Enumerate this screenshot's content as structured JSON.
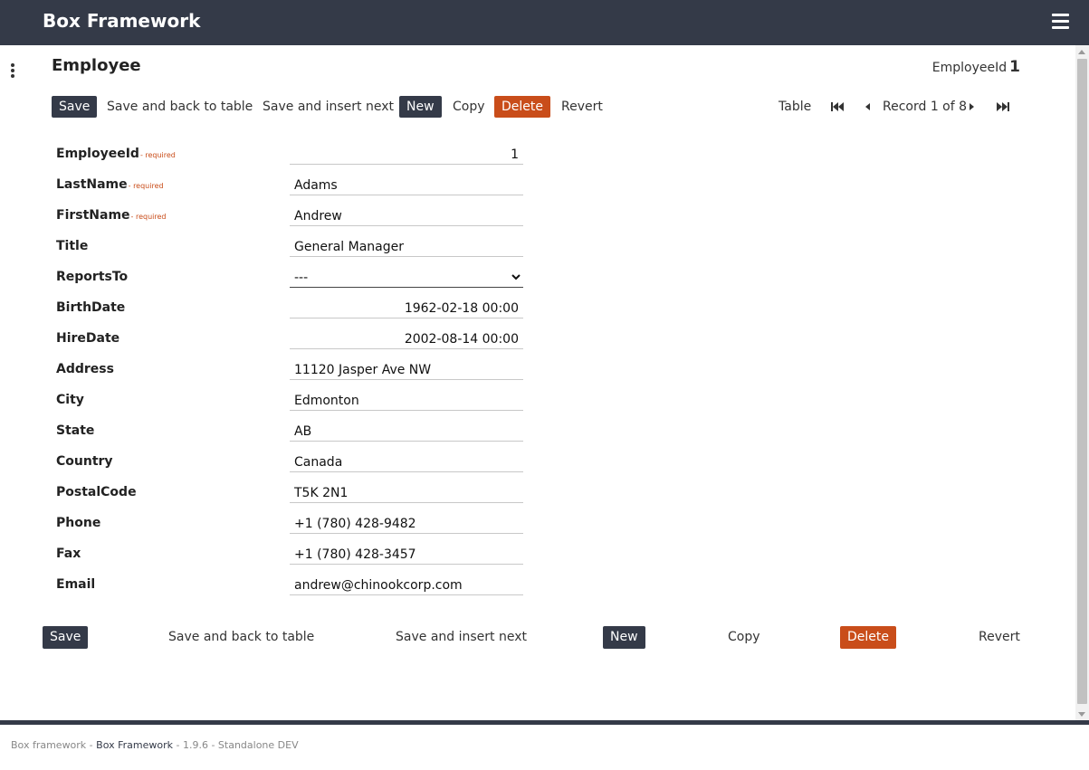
{
  "app": {
    "title": "Box Framework"
  },
  "page": {
    "title": "Employee",
    "id_label": "EmployeeId",
    "id_value": "1"
  },
  "toolbar": {
    "save": "Save",
    "save_back": "Save and back to table",
    "save_insert": "Save and insert next",
    "new": "New",
    "copy": "Copy",
    "delete": "Delete",
    "revert": "Revert"
  },
  "nav": {
    "table": "Table",
    "record": "Record 1 of 8"
  },
  "required_text": "- required",
  "fields": [
    {
      "label": "EmployeeId",
      "value": "1",
      "required": true
    },
    {
      "label": "LastName",
      "value": "Adams",
      "required": true
    },
    {
      "label": "FirstName",
      "value": "Andrew",
      "required": true
    },
    {
      "label": "Title",
      "value": "General Manager"
    },
    {
      "label": "ReportsTo",
      "value": "---"
    },
    {
      "label": "BirthDate",
      "value": "1962-02-18 00:00"
    },
    {
      "label": "HireDate",
      "value": "2002-08-14 00:00"
    },
    {
      "label": "Address",
      "value": "11120 Jasper Ave NW"
    },
    {
      "label": "City",
      "value": "Edmonton"
    },
    {
      "label": "State",
      "value": "AB"
    },
    {
      "label": "Country",
      "value": "Canada"
    },
    {
      "label": "PostalCode",
      "value": "T5K 2N1"
    },
    {
      "label": "Phone",
      "value": "+1 (780) 428-9482"
    },
    {
      "label": "Fax",
      "value": "+1 (780) 428-3457"
    },
    {
      "label": "Email",
      "value": "andrew@chinookcorp.com"
    }
  ],
  "footer": {
    "prefix": "Box framework - ",
    "link": "Box Framework",
    "suffix": " - 1.9.6 - Standalone DEV"
  },
  "colors": {
    "header": "#343a48",
    "accent": "#c94d1a",
    "background": "#ffffff"
  }
}
